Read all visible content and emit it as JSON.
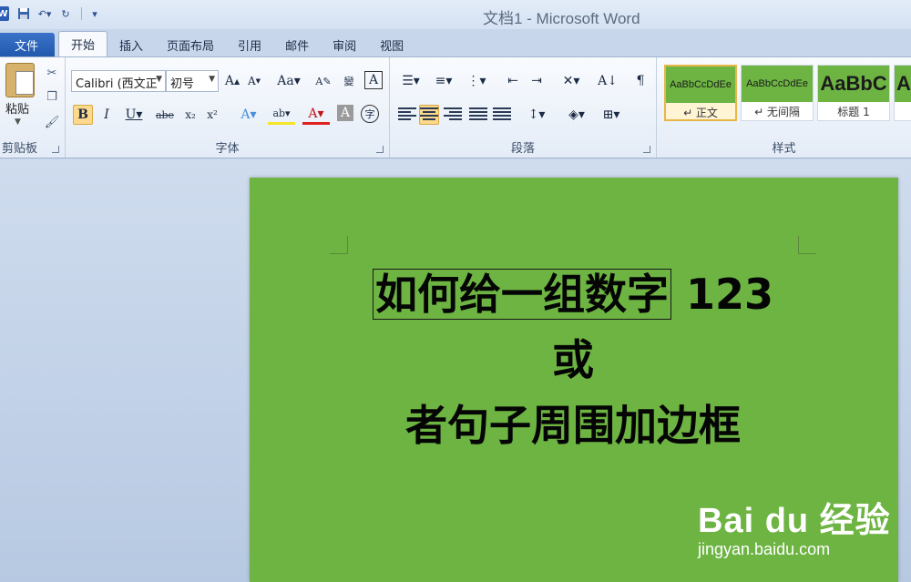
{
  "window": {
    "title": "文档1 - Microsoft Word"
  },
  "qat": {
    "word_icon": "W",
    "save_icon": "save-icon",
    "undo_icon": "undo-icon",
    "redo_icon": "redo-icon"
  },
  "tabs": {
    "file": "文件",
    "items": [
      "开始",
      "插入",
      "页面布局",
      "引用",
      "邮件",
      "审阅",
      "视图"
    ],
    "active": "开始"
  },
  "clipboard": {
    "paste": "粘贴",
    "label": "剪贴板"
  },
  "font": {
    "name": "Calibri (西文正",
    "size": "初号",
    "label": "字体"
  },
  "paragraph": {
    "label": "段落"
  },
  "styles": {
    "label": "样式",
    "items": [
      {
        "sample": "AaBbCcDdEe",
        "name": "↵ 正文"
      },
      {
        "sample": "AaBbCcDdEe",
        "name": "↵ 无间隔"
      },
      {
        "sample": "AaBbC",
        "name": "标题 1"
      },
      {
        "sample": "A",
        "name": ""
      }
    ]
  },
  "document": {
    "boxed_text": "如何给一组数字",
    "rest_line1": "123 或",
    "line2": "者句子周围加边框",
    "background_color": "#6db443"
  },
  "watermark": {
    "logo": "Bai du 经验",
    "url": "jingyan.baidu.com"
  }
}
